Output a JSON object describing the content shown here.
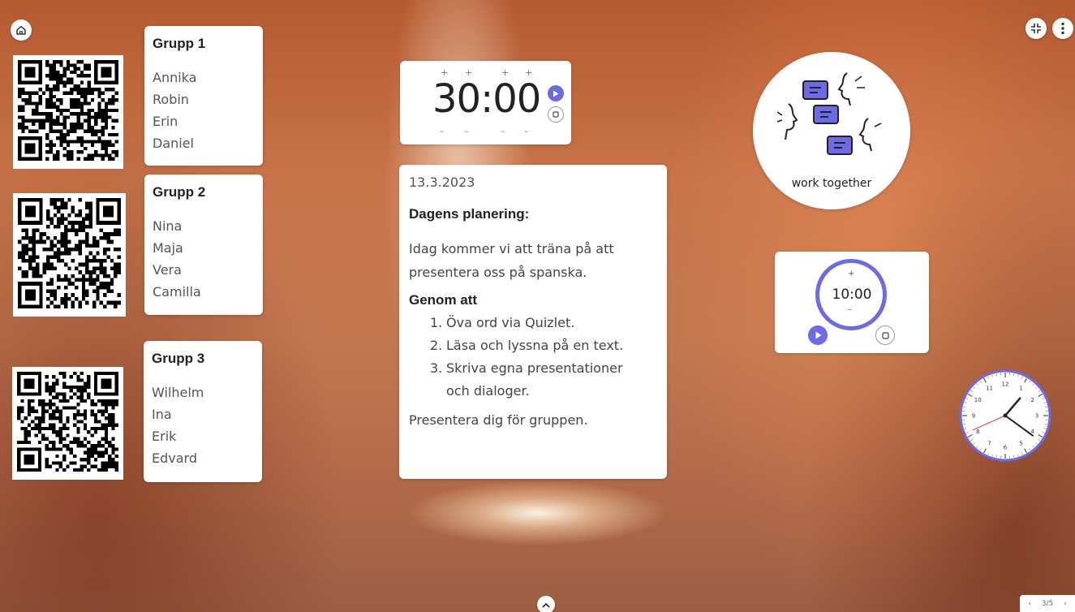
{
  "groups": [
    {
      "title": "Grupp 1",
      "members": [
        "Annika",
        "Robin",
        "Erin",
        "Daniel"
      ]
    },
    {
      "title": "Grupp 2",
      "members": [
        "Nina",
        "Maja",
        "Vera",
        "Camilla"
      ]
    },
    {
      "title": "Grupp 3",
      "members": [
        "Wilhelm",
        "Ina",
        "Erik",
        "Edvard"
      ]
    }
  ],
  "timer_main": {
    "display": "30:00",
    "plus": "+",
    "minus": "–"
  },
  "note": {
    "date": "13.3.2023",
    "heading": "Dagens planering:",
    "intro": "Idag kommer vi att träna på att presentera oss på spanska.",
    "subheading": "Genom att",
    "steps": [
      {
        "num": "1.",
        "text": "Öva ord via Quizlet."
      },
      {
        "num": "2.",
        "text": "Läsa och lyssna på en text."
      },
      {
        "num": "3.",
        "text": "Skriva egna presentationer och dialoger."
      }
    ],
    "closing": "Presentera dig för gruppen."
  },
  "work_together": {
    "label": "work together",
    "accent": "#6d6ae6"
  },
  "timer_small": {
    "display": "10:00",
    "plus": "+",
    "minus": "–"
  },
  "clock": {
    "numbers": [
      "12",
      "1",
      "2",
      "3",
      "4",
      "5",
      "6",
      "7",
      "8",
      "9",
      "10",
      "11"
    ],
    "hour": 1,
    "minute": 21,
    "second": 41
  },
  "pager": {
    "label": "3/5",
    "prev": "‹",
    "next": "›"
  },
  "colors": {
    "accent": "#6d6ae6",
    "card": "#ffffff"
  },
  "icons": {
    "home": "home-icon",
    "collapse": "collapse-icon",
    "more": "more-vertical-icon",
    "expand_up": "chevron-up-icon"
  }
}
